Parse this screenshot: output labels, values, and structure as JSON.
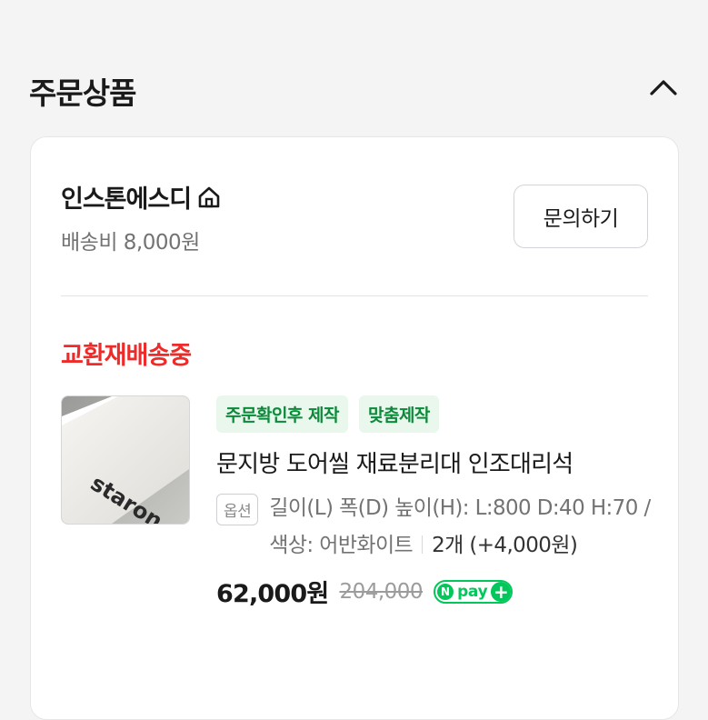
{
  "section": {
    "title": "주문상품",
    "collapse_icon": "chevron-up-icon"
  },
  "seller": {
    "name": "인스톤에스디",
    "store_icon": "home-icon",
    "shipping_fee": "배송비 8,000원",
    "inquiry_label": "문의하기"
  },
  "order": {
    "status": "교환재배송중",
    "status_color": "#ef2b2a",
    "product": {
      "image_text": "staron",
      "badges": [
        "주문확인후 제작",
        "맞춤제작"
      ],
      "name": "문지방 도어씰 재료분리대 인조대리석",
      "option_tag": "옵션",
      "option_text": "길이(L) 폭(D) 높이(H): L:800 D:40 H:70 / 색상: 어반화이트",
      "quantity_text": "2개 (+4,000원)",
      "price": "62,000원",
      "original_price": "204,000",
      "npay_label": "pay",
      "npay_color": "#03c75a"
    }
  }
}
